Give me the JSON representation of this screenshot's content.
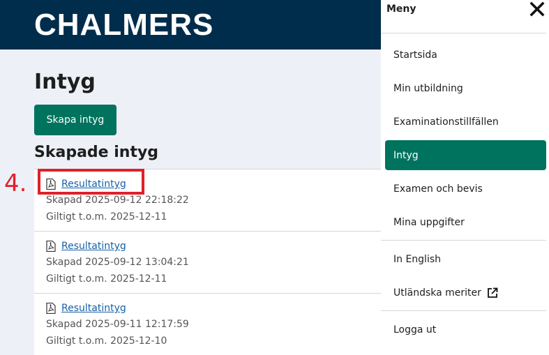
{
  "header": {
    "logo_text": "CHALMERS"
  },
  "main": {
    "title": "Intyg",
    "create_button": "Skapa intyg",
    "section_title": "Skapade intyg",
    "certificates": [
      {
        "name": "Resultatintyg",
        "created": "Skapad 2025-09-12 22:18:22",
        "valid": "Giltigt t.o.m. 2025-12-11"
      },
      {
        "name": "Resultatintyg",
        "created": "Skapad 2025-09-12 13:04:21",
        "valid": "Giltigt t.o.m. 2025-12-11"
      },
      {
        "name": "Resultatintyg",
        "created": "Skapad 2025-09-11 12:17:59",
        "valid": "Giltigt t.o.m. 2025-12-10"
      }
    ]
  },
  "annotation": {
    "step_label": "4.",
    "color": "#e0202a"
  },
  "menu": {
    "title": "Meny",
    "close_icon": "close-icon",
    "items": [
      {
        "label": "Startsida"
      },
      {
        "label": "Min utbildning"
      },
      {
        "label": "Examinationstillfällen"
      },
      {
        "label": "Intyg",
        "active": true
      },
      {
        "label": "Examen och bevis"
      },
      {
        "label": "Mina uppgifter"
      },
      {
        "label": "In English"
      },
      {
        "label": "Utländska meriter",
        "icon": "external-link-icon"
      },
      {
        "label": "Logga ut"
      }
    ]
  },
  "colors": {
    "header": "#002d4c",
    "accent": "#00735e",
    "link": "#1560a8"
  }
}
